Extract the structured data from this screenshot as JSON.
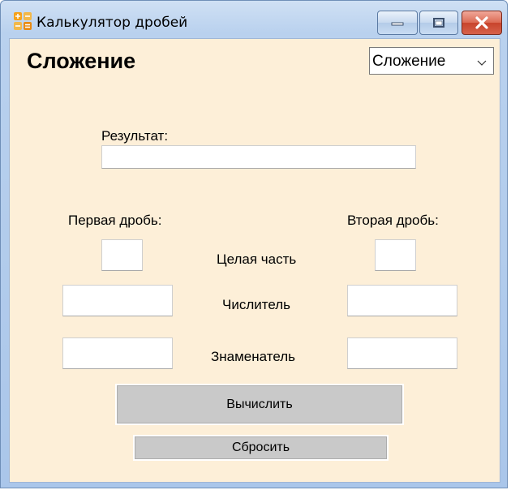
{
  "window": {
    "title": "Калькулятор дробей"
  },
  "header": {
    "heading": "Сложение",
    "operation_select": {
      "value": "Сложение"
    }
  },
  "result": {
    "label": "Результат:",
    "value": ""
  },
  "first_fraction": {
    "label": "Первая дробь:",
    "whole": "",
    "numerator": "",
    "denominator": ""
  },
  "second_fraction": {
    "label": "Вторая дробь:",
    "whole": "",
    "numerator": "",
    "denominator": ""
  },
  "row_labels": {
    "whole": "Целая часть",
    "numerator": "Числитель",
    "denominator": "Знаменатель"
  },
  "buttons": {
    "calculate": "Вычислить",
    "reset": "Сбросить"
  },
  "colors": {
    "client_background": "#fdefd8",
    "button_background": "#c9c9c9",
    "close_button": "#d6614a"
  }
}
